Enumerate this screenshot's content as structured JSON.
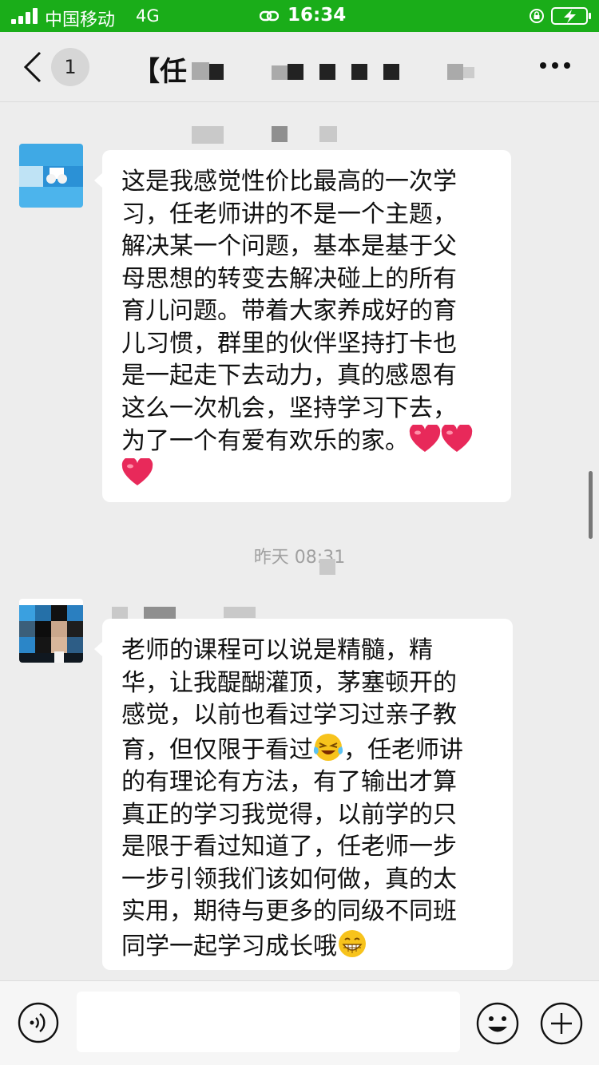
{
  "status_bar": {
    "carrier": "中国移动",
    "network": "4G",
    "time": "16:34"
  },
  "nav": {
    "badge_count": "1",
    "title": "【任"
  },
  "colors": {
    "wechat_green": "#1aad19",
    "heart": "#e8295a"
  },
  "messages": [
    {
      "lines": [
        "这是我感觉性价比最高的一次学",
        "习，任老师讲的不是一个主题，",
        "解决某一个问题，基本是基于父",
        "母思想的转变去解决碰上的所有",
        "育儿问题。带着大家养成好的育",
        "儿习惯，群里的伙伴坚持打卡也",
        "是一起走下去动力，真的感恩有",
        "这么一次机会，坚持学习下去，",
        "为了一个有爱有欢乐的家。"
      ],
      "emoji": [
        "heart-emoji",
        "heart-emoji",
        "heart-emoji"
      ]
    },
    {
      "lines": [
        "老师的课程可以说是精髓，精",
        "华，让我醍醐灌顶，茅塞顿开的",
        "感觉，以前也看过学习过亲子教",
        "育，但仅限于看过",
        "，任老师讲",
        "的有理论有方法，有了输出才算",
        "真正的学习我觉得，以前学的只",
        "是限于看过知道了，任老师一步",
        "一步引领我们该如何做，真的太",
        "实用，期待与更多的同级不同班",
        "同学一起学习成长哦"
      ],
      "emoji": [
        "laugh-cry-emoji",
        "grin-emoji"
      ]
    }
  ],
  "timestamp": "昨天 08:31",
  "input": {
    "value": ""
  }
}
